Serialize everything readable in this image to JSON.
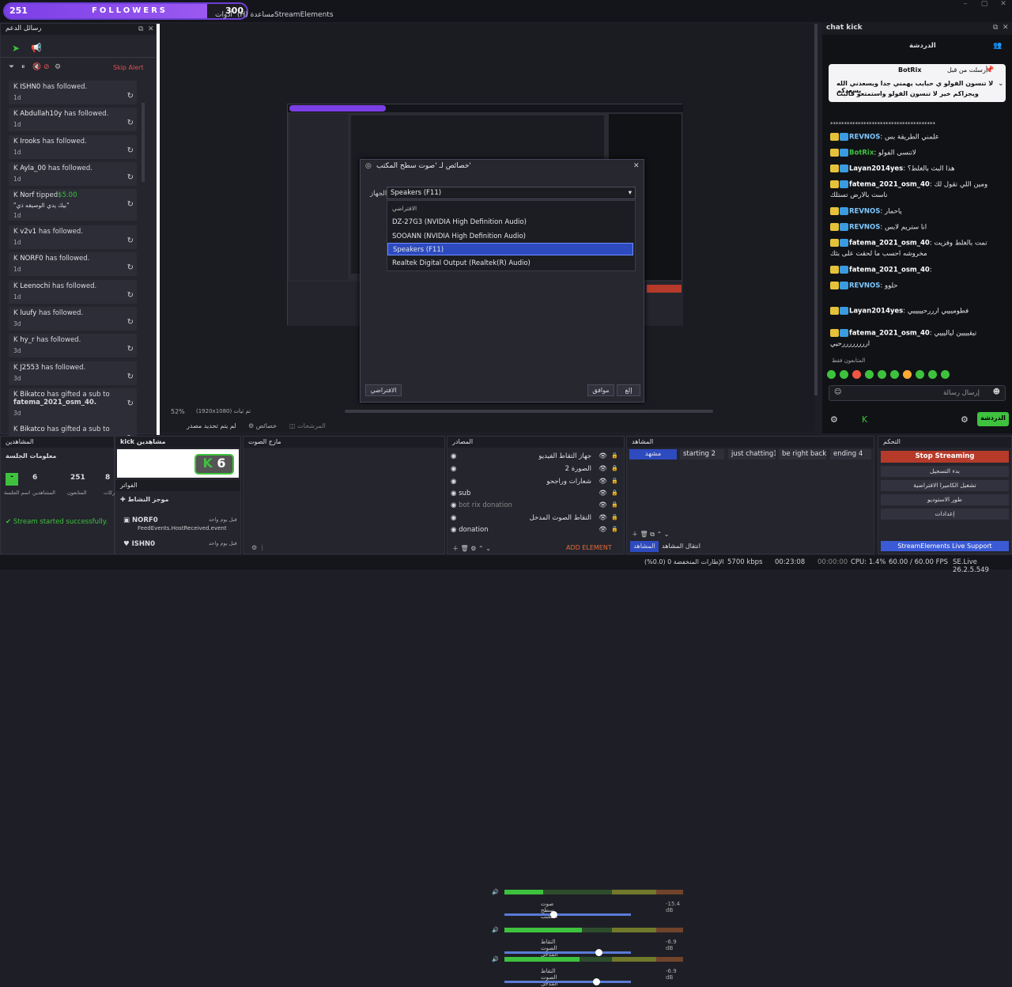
{
  "followers_bar": {
    "current": "251",
    "label": "FOLLOWERS",
    "goal": "300",
    "progress": 0.837
  },
  "menu": {
    "items": [
      "(H) مساعدة",
      "أدوات",
      "StreamElements"
    ]
  },
  "alerts": {
    "title": "رسائل الدعم",
    "skip_label": "Skip Alert",
    "items": [
      {
        "name": "ISHN0",
        "text": "has followed.",
        "time": "1d"
      },
      {
        "name": "Abdullah10y",
        "text": "has followed.",
        "time": "1d"
      },
      {
        "name": "Irooks",
        "text": "has followed.",
        "time": "1d"
      },
      {
        "name": "Ayla_00",
        "text": "has followed.",
        "time": "1d"
      },
      {
        "name": "Norf",
        "text": "tipped",
        "amount": "$5.00",
        "msg": "\"بيك يدي الوصيفه ذي\"",
        "time": "1d"
      },
      {
        "name": "v2v1",
        "text": "has followed.",
        "time": "1d"
      },
      {
        "name": "NORF0",
        "text": "has followed.",
        "time": "1d"
      },
      {
        "name": "Leenochi",
        "text": "has followed.",
        "time": "1d"
      },
      {
        "name": "luufy",
        "text": "has followed.",
        "time": "3d"
      },
      {
        "name": "hy_r",
        "text": "has followed.",
        "time": "3d"
      },
      {
        "name": "J2553",
        "text": "has followed.",
        "time": "3d"
      },
      {
        "name": "Bikatco",
        "text": "has gifted a sub to",
        "target": "fatema_2021_osm_40.",
        "time": "3d"
      },
      {
        "name": "Bikatco",
        "text": "has gifted a sub to",
        "time": ""
      }
    ]
  },
  "dialog": {
    "title": "خصائص لـ 'صوت سطح المكتب'",
    "device_label": "الجهاز",
    "selected": "Speakers (F11)",
    "options": [
      "الافتراضي",
      "DZ-27G3 (NVIDIA High Definition Audio)",
      "SOOANN (NVIDIA High Definition Audio)",
      "Speakers (F11)",
      "Realtek Digital Output (Realtek(R) Audio)"
    ],
    "defaults_btn": "الافتراضي",
    "ok_btn": "موافق",
    "cancel_btn": "إلغ"
  },
  "preview_bar": {
    "zoom": "52%",
    "res": "(1920x1080) تم ثيات",
    "no_source": "لم يتم تحديد مصدر",
    "props": "خصائص",
    "filters": "المرشحات"
  },
  "chat": {
    "title": "chat kick",
    "tab": "الدردشة",
    "pinned_user": "BotRix",
    "pinned_by": "أرسلت من قبل",
    "pinned_msg": "لا تنسون الفولو ي حبايب يهمني جدا ويسعدني الله يسعدكم",
    "pinned_msg2": "ويجزاكم خير لا تنسون الفولو واستمتعو فالبث",
    "lines": [
      {
        "user": "REVNOS",
        "msg": "علمني الطريقة بس"
      },
      {
        "user": "BotRix",
        "msg": "لاتنسى الفولو"
      },
      {
        "user": "Layan2014yes",
        "msg": "هذا البث بالغلط؟"
      },
      {
        "user": "fatema_2021_osm_40",
        "msg": "ومين اللي تقول لك"
      },
      {
        "user": "",
        "msg": "ناست بالارض تستلك"
      },
      {
        "user": "REVNOS",
        "msg": "ياحمار"
      },
      {
        "user": "REVNOS",
        "msg": "انا ستريم لابس"
      },
      {
        "user": "fatema_2021_osm_40",
        "msg": "تمت بالغلط وفزيت"
      },
      {
        "user": "",
        "msg": "مخروشه احسب ما لحقت على بثك"
      },
      {
        "user": "fatema_2021_osm_40",
        "msg": ""
      },
      {
        "user": "REVNOS",
        "msg": "حلوو"
      },
      {
        "user": "Layan2014yes",
        "msg": "فطوميييي ارررحيييييي"
      },
      {
        "user": "fatema_2021_osm_40",
        "msg": "تيقيييين لياليييي"
      },
      {
        "user": "",
        "msg": "اررررررررحيي"
      }
    ],
    "viewers_label": "المتابعون فقط",
    "input_placeholder": "إرسال رسالة",
    "send_btn": "الدردشة"
  },
  "docks": {
    "viewers": {
      "title": "المشاهدين",
      "session": "معلومات الجلسة",
      "stats": [
        {
          "label": "اسم الجلسة",
          "value": "-"
        },
        {
          "label": "المشاهدين",
          "value": "6"
        },
        {
          "label": "المتابعون",
          "value": "251"
        },
        {
          "label": "المشتركات",
          "value": "8"
        }
      ],
      "status": "Stream started successfully."
    },
    "kick": {
      "title": "kick مشاهدين",
      "count": "6"
    },
    "events": {
      "title": "الفواتر",
      "tab": "موجز النشاط",
      "items": [
        {
          "name": "NORF0",
          "detail": "FeedEvents.HostReceived.event",
          "time": "قبل يوم واحد"
        },
        {
          "name": "ISHN0",
          "detail": "",
          "time": "قبل يوم واحد"
        }
      ]
    },
    "mixer": {
      "title": "مازج الصوت",
      "channels": [
        {
          "name": "صوت سطح المكتب",
          "db": "-15.4 dB",
          "level": 0.36
        },
        {
          "name": "التقاط الصوت المدخل",
          "db": "-6.9 dB",
          "level": 0.72
        },
        {
          "name": "التقاط الصوت المدخل",
          "db": "-6.9 dB",
          "level": 0.7
        }
      ],
      "ticks": [
        "-60",
        "-55",
        "-50",
        "-45",
        "-40",
        "-35",
        "-30",
        "-25",
        "-20",
        "-15",
        "-10",
        "-5",
        "0"
      ]
    },
    "sources": {
      "title": "المصادر",
      "items": [
        "جهاز التقاط الفيديو",
        "الصورة 2",
        "شعارات وراجحو",
        "sub",
        "bot rix donation",
        "التقاط الصوت المدخل",
        "donation"
      ],
      "add": "ADD ELEMENT"
    },
    "scenes": {
      "title": "المشاهد",
      "items": [
        "مشهد",
        "starting 2",
        "just chatting1",
        "be right back",
        "ending 4"
      ],
      "tabs": [
        "المشاهد",
        "انتقال المشاهد"
      ]
    },
    "controls": {
      "title": "التحكم",
      "buttons": [
        "Stop Streaming",
        "بدء التسجيل",
        "تشغيل الكاميرا الافتراضية",
        "طور الاستوديو",
        "إعدادات"
      ],
      "support": "StreamElements Live Support"
    }
  },
  "status": {
    "dropped": "الإطارات المنخفضة 0 (0.0%)",
    "bitrate": "5700 kbps",
    "time": "00:23:08",
    "rec": "00:00:00",
    "cpu": "CPU: 1.4%",
    "fps": "60.00 / 60.00 FPS",
    "version": "SE.Live 26.2.5.549"
  },
  "colors": {
    "accent": "#7b3fe6",
    "green": "#3ec23e",
    "red": "#b63a2a",
    "select": "#2d4bbf"
  }
}
